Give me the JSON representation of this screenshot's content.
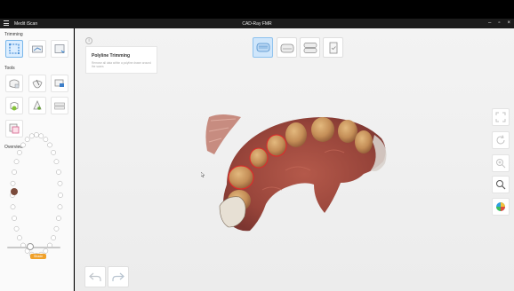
{
  "window": {
    "app_title": "Medit iScan",
    "document_title": "CAD-Ray FMR",
    "minimize_glyph": "–",
    "restore_glyph": "▫",
    "close_glyph": "×"
  },
  "sidebar": {
    "trimming_label": "Trimming",
    "tools_label": "Tools",
    "overview_label": "Overview",
    "shade_badge": "Shade"
  },
  "tooltip": {
    "info_glyph": "i",
    "title": "Polyline Trimming",
    "description": "Remove all data within a polyline drawn around the scans"
  },
  "icons": {
    "menu": "menu-icon",
    "polyline-trim": "polyline-trim-icon",
    "brush-trim": "brush-trim-icon",
    "lock-tooth": "lock-tooth-icon",
    "fit": "fit-screen-icon",
    "rotate": "rotate-icon",
    "zoom-in": "zoom-in-icon",
    "zoom": "zoom-icon",
    "color-map": "color-map-icon",
    "undo": "undo-icon",
    "redo": "redo-icon"
  },
  "colors": {
    "accent": "#7ab7ea",
    "active_fill": "#cfe6fb",
    "badge": "#f0a12a",
    "scan_gum": "#a5493a",
    "scan_tooth": "#d0a06a"
  }
}
